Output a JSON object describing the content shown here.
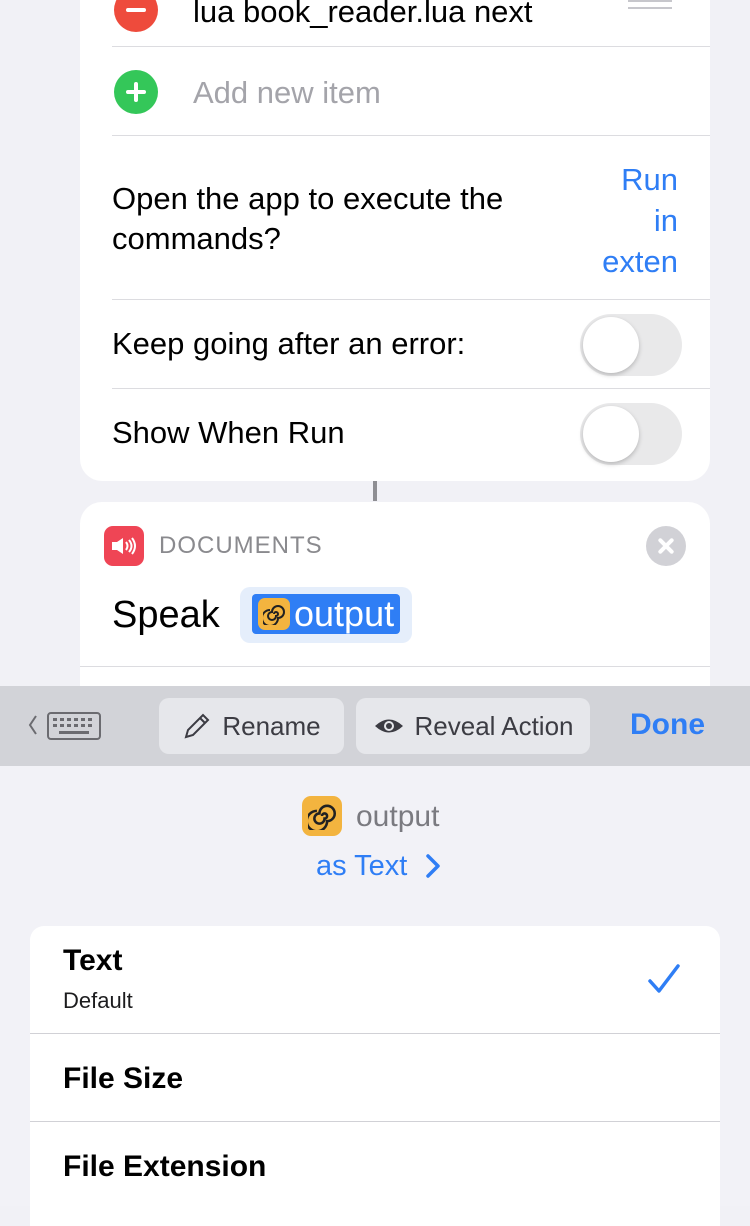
{
  "list": {
    "items": [
      {
        "text": "lua book_reader.lua next"
      }
    ],
    "add_placeholder": "Add new item"
  },
  "settings": {
    "open_app": {
      "label_line1": "Open the app to execute the",
      "label_line2": "commands?",
      "value_line1": "Run",
      "value_line2": "in",
      "value_line3": "exten"
    },
    "keep_going": {
      "label": "Keep going after an error:",
      "on": false
    },
    "show_when_run": {
      "label": "Show When Run",
      "on": false
    }
  },
  "action": {
    "category": "DOCUMENTS",
    "verb": "Speak",
    "token_label": "output"
  },
  "toolbar": {
    "rename_label": "Rename",
    "reveal_label": "Reveal Action",
    "done_label": "Done"
  },
  "variable": {
    "name": "output",
    "as_type": "as Text"
  },
  "types": [
    {
      "title": "Text",
      "subtitle": "Default",
      "selected": true
    },
    {
      "title": "File Size",
      "subtitle": "",
      "selected": false
    },
    {
      "title": "File Extension",
      "subtitle": "",
      "selected": false
    }
  ],
  "colors": {
    "accent": "#2f7ef5",
    "remove": "#ee4b3c",
    "add": "#34c759",
    "documents": "#ef4555",
    "variable_icon": "#f3b43f"
  }
}
